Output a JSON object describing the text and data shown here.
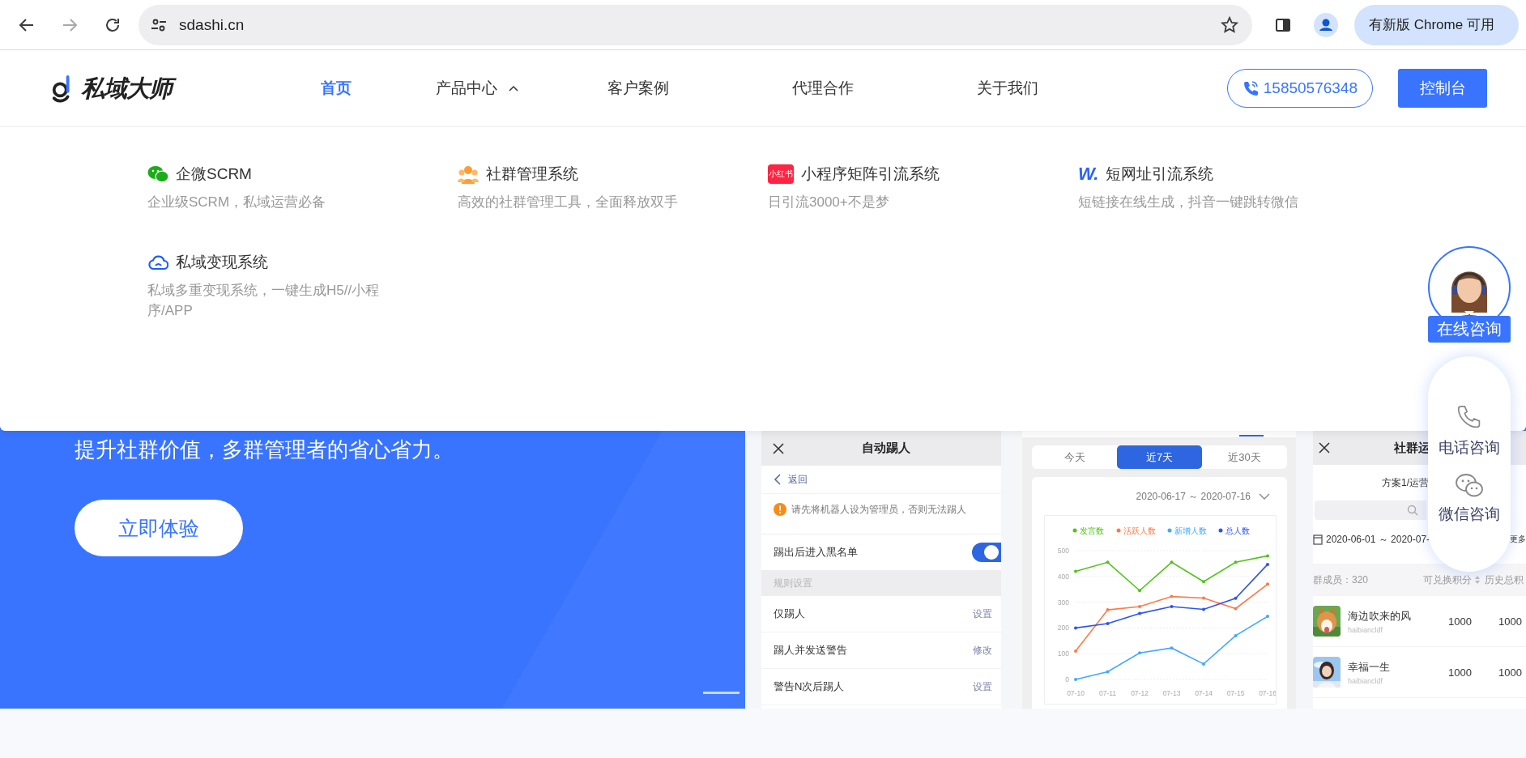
{
  "browser": {
    "address": "sdashi.cn",
    "update_button": "有新版 Chrome 可用"
  },
  "nav": {
    "logo_text": "私域大师",
    "items": [
      {
        "label": "首页",
        "selected": true
      },
      {
        "label": "产品中心",
        "selected": false,
        "expanded": true
      },
      {
        "label": "客户案例",
        "selected": false
      },
      {
        "label": "代理合作",
        "selected": false
      },
      {
        "label": "关于我们",
        "selected": false
      }
    ],
    "phone": "15850576348",
    "console_button": "控制台"
  },
  "product_menu": [
    {
      "kind": "wechat",
      "title": "企微SCRM",
      "description": "企业级SCRM，私域运营必备"
    },
    {
      "kind": "group",
      "title": "社群管理系统",
      "description": "高效的社群管理工具，全面释放双手"
    },
    {
      "kind": "badge",
      "icon_text": "小红书",
      "title": "小程序矩阵引流系统",
      "description": "日引流3000+不是梦"
    },
    {
      "kind": "letter",
      "icon_text": "W.",
      "title": "短网址引流系统",
      "description": "短链接在线生成，抖音一键跳转微信"
    },
    {
      "kind": "cloud",
      "title": "私域变现系统",
      "description": "私域多重变现系统，一键生成H5//小程序/APP"
    }
  ],
  "hero": {
    "tagline": "提升社群价值，多群管理者的省心省力。",
    "button": "立即体验"
  },
  "kick_panel": {
    "title": "自动踢人",
    "back": "返回",
    "warning": "请先将机器人设为管理员，否则无法踢人",
    "toggle": {
      "label": "踢出后进入黑名单",
      "on": true
    },
    "section": "规则设置",
    "rules": [
      {
        "label": "仅踢人",
        "action": "设置"
      },
      {
        "label": "踢人并发送警告",
        "action": "修改"
      },
      {
        "label": "警告N次后踢人",
        "action": "设置"
      }
    ]
  },
  "stats_panel": {
    "ranges": [
      {
        "label": "今天",
        "selected": false
      },
      {
        "label": "近7天",
        "selected": true
      },
      {
        "label": "近30天",
        "selected": false
      }
    ],
    "date_range": "2020-06-17 ～ 2020-07-16",
    "chart_data": {
      "type": "line",
      "grid": true,
      "categories": [
        "07-10",
        "07-11",
        "07-12",
        "07-13",
        "07-14",
        "07-15",
        "07-16"
      ],
      "ylim": [
        0,
        500
      ],
      "yticks": [
        0,
        100,
        200,
        300,
        400,
        500
      ],
      "series": [
        {
          "name": "发言数",
          "color": "#52c41a",
          "values": [
            420,
            455,
            345,
            455,
            380,
            455,
            480
          ]
        },
        {
          "name": "活跃人数",
          "color": "#ff7a45",
          "values": [
            110,
            270,
            283,
            322,
            316,
            275,
            370
          ]
        },
        {
          "name": "新增人数",
          "color": "#40a9ff",
          "values": [
            0,
            30,
            103,
            122,
            60,
            170,
            245
          ]
        },
        {
          "name": "总人数",
          "color": "#2f54eb",
          "values": [
            200,
            217,
            256,
            283,
            272,
            315,
            447
          ]
        }
      ]
    }
  },
  "member_panel": {
    "title": "社群运",
    "plan": "方案1/运营",
    "date_range": "2020-06-01 ～ 2020-07-",
    "more": "更多",
    "member_count": "群成员：320",
    "columns": [
      "可兑换积分",
      "历史总积"
    ],
    "rows": [
      {
        "name": "海边吹来的风",
        "handle": "haibiancldf",
        "values": [
          "1000",
          "1000"
        ]
      },
      {
        "name": "幸福一生",
        "handle": "haibiancldf",
        "values": [
          "1000",
          "1000"
        ]
      }
    ]
  },
  "float_widget": {
    "online": "在线咨询",
    "actions": [
      {
        "kind": "phone",
        "label": "电话咨询"
      },
      {
        "kind": "wechat",
        "label": "微信咨询"
      }
    ]
  }
}
